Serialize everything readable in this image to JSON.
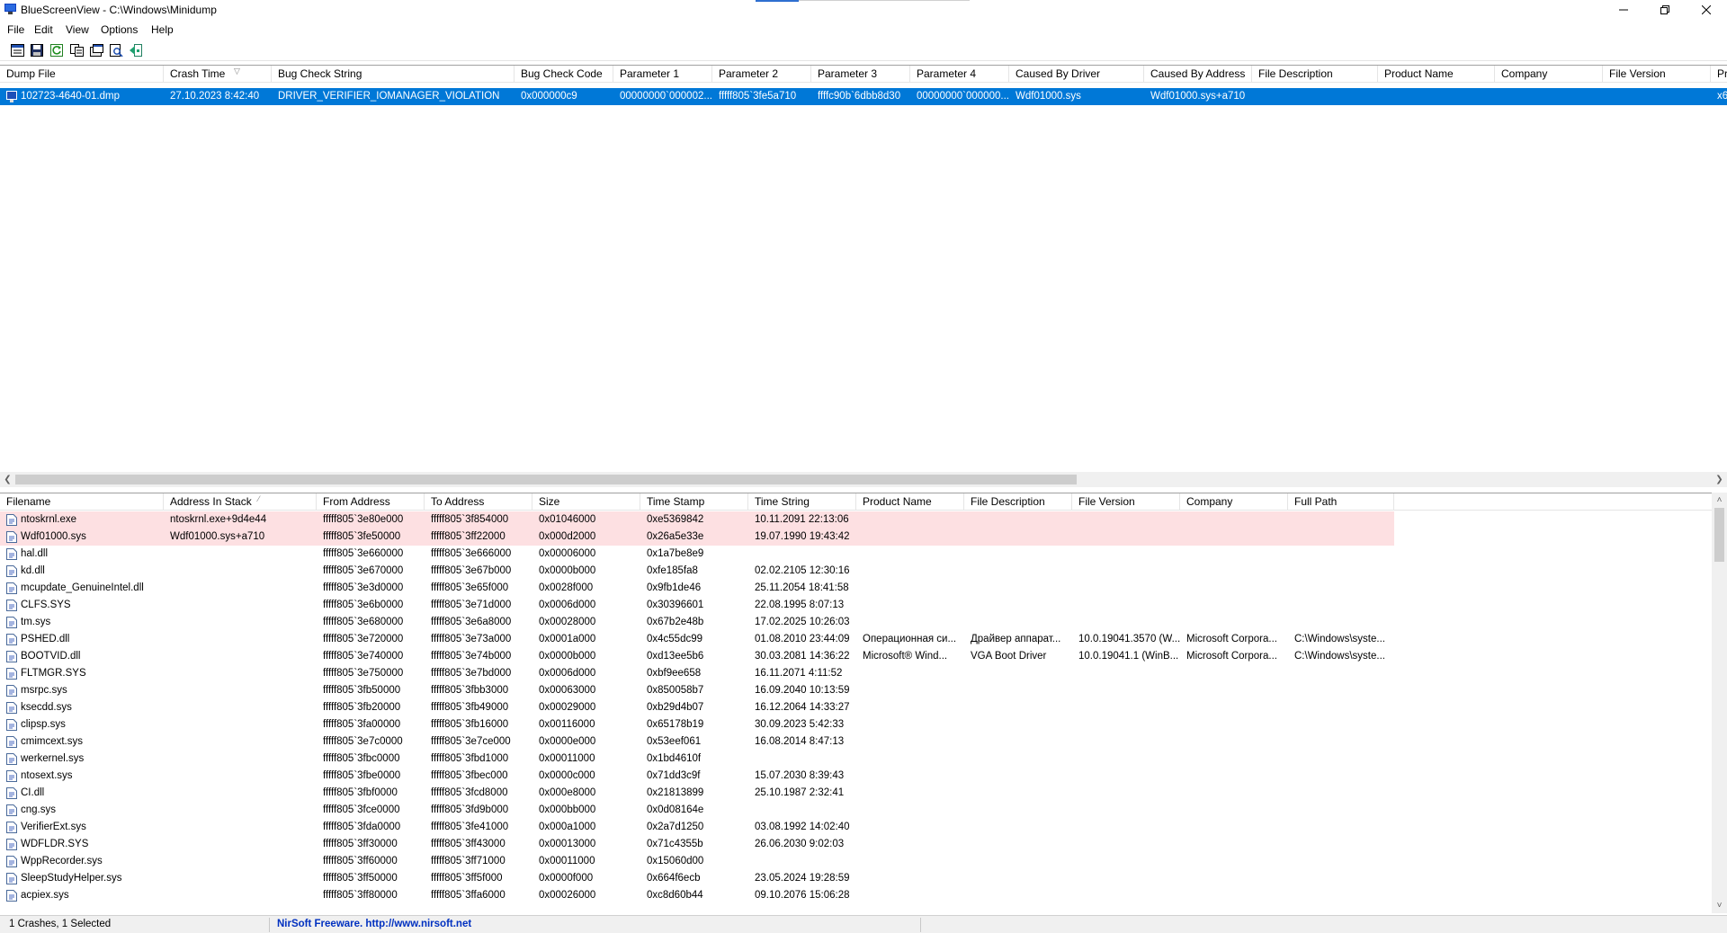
{
  "window": {
    "title": "BlueScreenView  -  C:\\Windows\\Minidump",
    "controls": [
      "minimize",
      "restore",
      "close"
    ]
  },
  "menu": [
    "File",
    "Edit",
    "View",
    "Options",
    "Help"
  ],
  "toolbar": {
    "buttons": [
      "properties-icon",
      "save-icon",
      "refresh-icon",
      "copy-icon",
      "advanced-options-icon",
      "find-icon",
      "exit-icon"
    ]
  },
  "crashes": {
    "columns": [
      "Dump File",
      "Crash Time",
      "Bug Check String",
      "Bug Check Code",
      "Parameter 1",
      "Parameter 2",
      "Parameter 3",
      "Parameter 4",
      "Caused By Driver",
      "Caused By Address",
      "File Description",
      "Product Name",
      "Company",
      "File Version",
      "Pr"
    ],
    "rows": [
      [
        "102723-4640-01.dmp",
        "27.10.2023 8:42:40",
        "DRIVER_VERIFIER_IOMANAGER_VIOLATION",
        "0x000000c9",
        "00000000`000002...",
        "fffff805`3fe5a710",
        "ffffc90b`6dbb8d30",
        "00000000`000000...",
        "Wdf01000.sys",
        "Wdf01000.sys+a710",
        "",
        "",
        "",
        "",
        "x6"
      ]
    ],
    "selected_index": 0
  },
  "drivers": {
    "columns": [
      "Filename",
      "Address In Stack",
      "From Address",
      "To Address",
      "Size",
      "Time Stamp",
      "Time String",
      "Product Name",
      "File Description",
      "File Version",
      "Company",
      "Full Path"
    ],
    "rows": [
      [
        "ntoskrnl.exe",
        "ntoskrnl.exe+9d4e44",
        "fffff805`3e80e000",
        "fffff805`3f854000",
        "0x01046000",
        "0xe5369842",
        "10.11.2091 22:13:06",
        "",
        "",
        "",
        "",
        ""
      ],
      [
        "Wdf01000.sys",
        "Wdf01000.sys+a710",
        "fffff805`3fe50000",
        "fffff805`3ff22000",
        "0x000d2000",
        "0x26a5e33e",
        "19.07.1990 19:43:42",
        "",
        "",
        "",
        "",
        ""
      ],
      [
        "hal.dll",
        "",
        "fffff805`3e660000",
        "fffff805`3e666000",
        "0x00006000",
        "0x1a7be8e9",
        "",
        "",
        "",
        "",
        "",
        ""
      ],
      [
        "kd.dll",
        "",
        "fffff805`3e670000",
        "fffff805`3e67b000",
        "0x0000b000",
        "0xfe185fa8",
        "02.02.2105 12:30:16",
        "",
        "",
        "",
        "",
        ""
      ],
      [
        "mcupdate_GenuineIntel.dll",
        "",
        "fffff805`3e3d0000",
        "fffff805`3e65f000",
        "0x0028f000",
        "0x9fb1de46",
        "25.11.2054 18:41:58",
        "",
        "",
        "",
        "",
        ""
      ],
      [
        "CLFS.SYS",
        "",
        "fffff805`3e6b0000",
        "fffff805`3e71d000",
        "0x0006d000",
        "0x30396601",
        "22.08.1995 8:07:13",
        "",
        "",
        "",
        "",
        ""
      ],
      [
        "tm.sys",
        "",
        "fffff805`3e680000",
        "fffff805`3e6a8000",
        "0x00028000",
        "0x67b2e48b",
        "17.02.2025 10:26:03",
        "",
        "",
        "",
        "",
        ""
      ],
      [
        "PSHED.dll",
        "",
        "fffff805`3e720000",
        "fffff805`3e73a000",
        "0x0001a000",
        "0x4c55dc99",
        "01.08.2010 23:44:09",
        "Операционная си...",
        "Драйвер аппарат...",
        "10.0.19041.3570 (W...",
        "Microsoft Corpora...",
        "C:\\Windows\\syste..."
      ],
      [
        "BOOTVID.dll",
        "",
        "fffff805`3e740000",
        "fffff805`3e74b000",
        "0x0000b000",
        "0xd13ee5b6",
        "30.03.2081 14:36:22",
        "Microsoft® Wind...",
        "VGA Boot Driver",
        "10.0.19041.1 (WinB...",
        "Microsoft Corpora...",
        "C:\\Windows\\syste..."
      ],
      [
        "FLTMGR.SYS",
        "",
        "fffff805`3e750000",
        "fffff805`3e7bd000",
        "0x0006d000",
        "0xbf9ee658",
        "16.11.2071 4:11:52",
        "",
        "",
        "",
        "",
        ""
      ],
      [
        "msrpc.sys",
        "",
        "fffff805`3fb50000",
        "fffff805`3fbb3000",
        "0x00063000",
        "0x850058b7",
        "16.09.2040 10:13:59",
        "",
        "",
        "",
        "",
        ""
      ],
      [
        "ksecdd.sys",
        "",
        "fffff805`3fb20000",
        "fffff805`3fb49000",
        "0x00029000",
        "0xb29d4b07",
        "16.12.2064 14:33:27",
        "",
        "",
        "",
        "",
        ""
      ],
      [
        "clipsp.sys",
        "",
        "fffff805`3fa00000",
        "fffff805`3fb16000",
        "0x00116000",
        "0x65178b19",
        "30.09.2023 5:42:33",
        "",
        "",
        "",
        "",
        ""
      ],
      [
        "cmimcext.sys",
        "",
        "fffff805`3e7c0000",
        "fffff805`3e7ce000",
        "0x0000e000",
        "0x53eef061",
        "16.08.2014 8:47:13",
        "",
        "",
        "",
        "",
        ""
      ],
      [
        "werkernel.sys",
        "",
        "fffff805`3fbc0000",
        "fffff805`3fbd1000",
        "0x00011000",
        "0x1bd4610f",
        "",
        "",
        "",
        "",
        "",
        ""
      ],
      [
        "ntosext.sys",
        "",
        "fffff805`3fbe0000",
        "fffff805`3fbec000",
        "0x0000c000",
        "0x71dd3c9f",
        "15.07.2030 8:39:43",
        "",
        "",
        "",
        "",
        ""
      ],
      [
        "CI.dll",
        "",
        "fffff805`3fbf0000",
        "fffff805`3fcd8000",
        "0x000e8000",
        "0x21813899",
        "25.10.1987 2:32:41",
        "",
        "",
        "",
        "",
        ""
      ],
      [
        "cng.sys",
        "",
        "fffff805`3fce0000",
        "fffff805`3fd9b000",
        "0x000bb000",
        "0x0d08164e",
        "",
        "",
        "",
        "",
        "",
        ""
      ],
      [
        "VerifierExt.sys",
        "",
        "fffff805`3fda0000",
        "fffff805`3fe41000",
        "0x000a1000",
        "0x2a7d1250",
        "03.08.1992 14:02:40",
        "",
        "",
        "",
        "",
        ""
      ],
      [
        "WDFLDR.SYS",
        "",
        "fffff805`3ff30000",
        "fffff805`3ff43000",
        "0x00013000",
        "0x71c4355b",
        "26.06.2030 9:02:03",
        "",
        "",
        "",
        "",
        ""
      ],
      [
        "WppRecorder.sys",
        "",
        "fffff805`3ff60000",
        "fffff805`3ff71000",
        "0x00011000",
        "0x15060d00",
        "",
        "",
        "",
        "",
        "",
        ""
      ],
      [
        "SleepStudyHelper.sys",
        "",
        "fffff805`3ff50000",
        "fffff805`3ff5f000",
        "0x0000f000",
        "0x664f6ecb",
        "23.05.2024 19:28:59",
        "",
        "",
        "",
        "",
        ""
      ],
      [
        "acpiex.sys",
        "",
        "fffff805`3ff80000",
        "fffff805`3ffa6000",
        "0x00026000",
        "0xc8d60b44",
        "09.10.2076 15:06:28",
        "",
        "",
        "",
        "",
        ""
      ]
    ],
    "highlighted_rows": [
      0,
      1
    ]
  },
  "status": {
    "left": "1 Crashes, 1 Selected",
    "right": "NirSoft Freeware.  http://www.nirsoft.net"
  },
  "colors": {
    "selection": "#0078d7",
    "highlight": "#fde0e2",
    "link": "#0030c0"
  }
}
